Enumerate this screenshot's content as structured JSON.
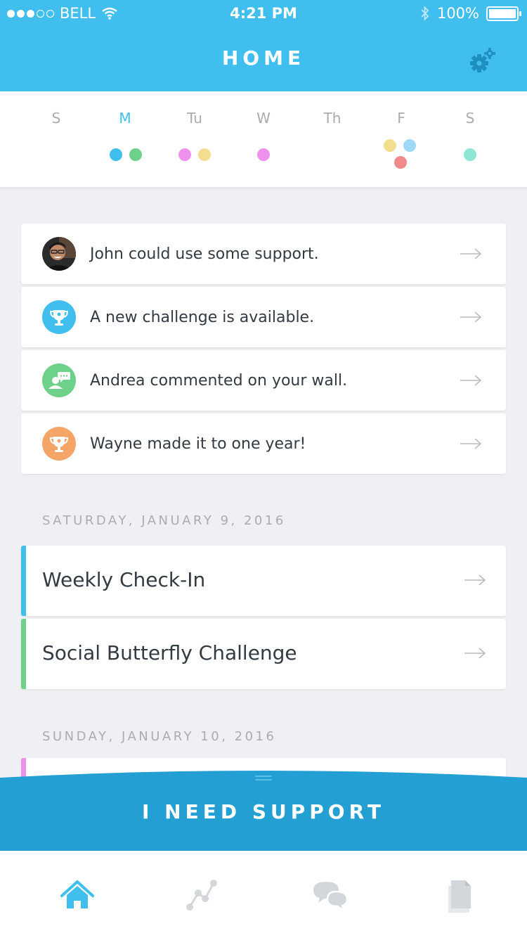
{
  "status_bar": {
    "carrier": "BELL",
    "time": "4:21 PM",
    "battery": "100%"
  },
  "header": {
    "title": "HOME"
  },
  "week": {
    "days": [
      {
        "label": "S",
        "active": false,
        "dots": []
      },
      {
        "label": "M",
        "active": true,
        "dots": [
          "#40bfee",
          "#6dd18a"
        ]
      },
      {
        "label": "Tu",
        "active": false,
        "dots": [
          "#ee90ee",
          "#f3dd8f"
        ]
      },
      {
        "label": "W",
        "active": false,
        "dots": [
          "#ee90ee"
        ]
      },
      {
        "label": "Th",
        "active": false,
        "dots": []
      },
      {
        "label": "F",
        "active": false,
        "dots": [
          "#f3dd8f",
          "#9fd9f5",
          "#f28a8a"
        ]
      },
      {
        "label": "S",
        "active": false,
        "dots": [
          "#8ee6d2"
        ]
      }
    ]
  },
  "notifications": [
    {
      "text": "John could use some support.",
      "icon": "user-photo",
      "color": "#3a3a3a"
    },
    {
      "text": "A new challenge is available.",
      "icon": "trophy-icon",
      "color": "#40bfee"
    },
    {
      "text": "Andrea commented on your wall.",
      "icon": "comment-user-icon",
      "color": "#6dd18a"
    },
    {
      "text": "Wayne made it to one year!",
      "icon": "trophy-icon",
      "color": "#f5a468"
    }
  ],
  "sections": [
    {
      "date": "SATURDAY, JANUARY 9, 2016",
      "items": [
        {
          "title": "Weekly Check-In",
          "accent": "#40bfee"
        },
        {
          "title": "Social Butterfly Challenge",
          "accent": "#6dd18a"
        }
      ]
    },
    {
      "date": "SUNDAY, JANUARY 10, 2016",
      "items": [
        {
          "title": "",
          "accent": "#ee90ee"
        }
      ]
    }
  ],
  "support_button": {
    "label": "I NEED SUPPORT",
    "color": "#249fd3"
  },
  "tabs": [
    {
      "name": "home",
      "icon": "home-icon",
      "active": true
    },
    {
      "name": "progress",
      "icon": "progress-graph-icon",
      "active": false
    },
    {
      "name": "chat",
      "icon": "chat-bubbles-icon",
      "active": false
    },
    {
      "name": "documents",
      "icon": "documents-icon",
      "active": false
    }
  ],
  "colors": {
    "primary": "#40bfee",
    "support": "#249fd3",
    "background": "#eff0f4"
  }
}
